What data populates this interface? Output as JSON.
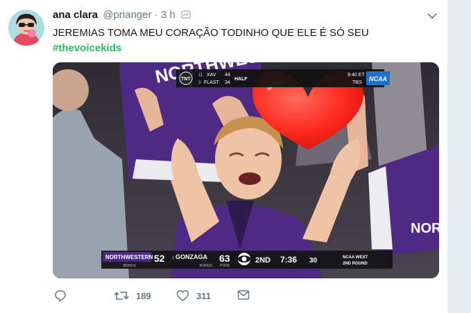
{
  "tweet": {
    "author_name": "ana clara",
    "author_handle": "@prianger",
    "separator": "·",
    "time": "3 h",
    "text": "JEREMIAS TOMA MEU CORAÇÃO TODINHO QUE ELE É SÓ SEU",
    "hashtag": "#thevoicekids"
  },
  "media": {
    "scoreboard": {
      "team1": "NORTHWESTERN",
      "team1_sub": "BONUS",
      "score1": "52",
      "team2_seed": "1",
      "team2": "GONZAGA",
      "team2_sub": "BONUS",
      "team2_poss": "POSS",
      "score2": "63",
      "period": "2ND",
      "clock": "7:36",
      "shot_clock": "30",
      "region_line1": "NCAA WEST",
      "region_line2": "2ND ROUND"
    },
    "top_bug": {
      "network": "TNT",
      "seed1": "11",
      "abbr1": "XAV",
      "score1": "44",
      "seed2": "3",
      "abbr2": "FLAST",
      "score2": "34",
      "period": "HALF",
      "time": "9:40 ET",
      "channel": "TBS",
      "league": "NCAA"
    },
    "jersey_text": "NORTHWESTERN",
    "right_jersey_text": "NORT"
  },
  "actions": {
    "retweets": "189",
    "likes": "311"
  },
  "colors": {
    "hashtag": "#2fb361",
    "meta": "#657786",
    "purple": "#4e2a84",
    "heart": "#ff2a1f"
  },
  "icons": [
    "reply-icon",
    "retweet-icon",
    "like-icon",
    "message-icon",
    "caret-down-icon",
    "verified-icon"
  ]
}
